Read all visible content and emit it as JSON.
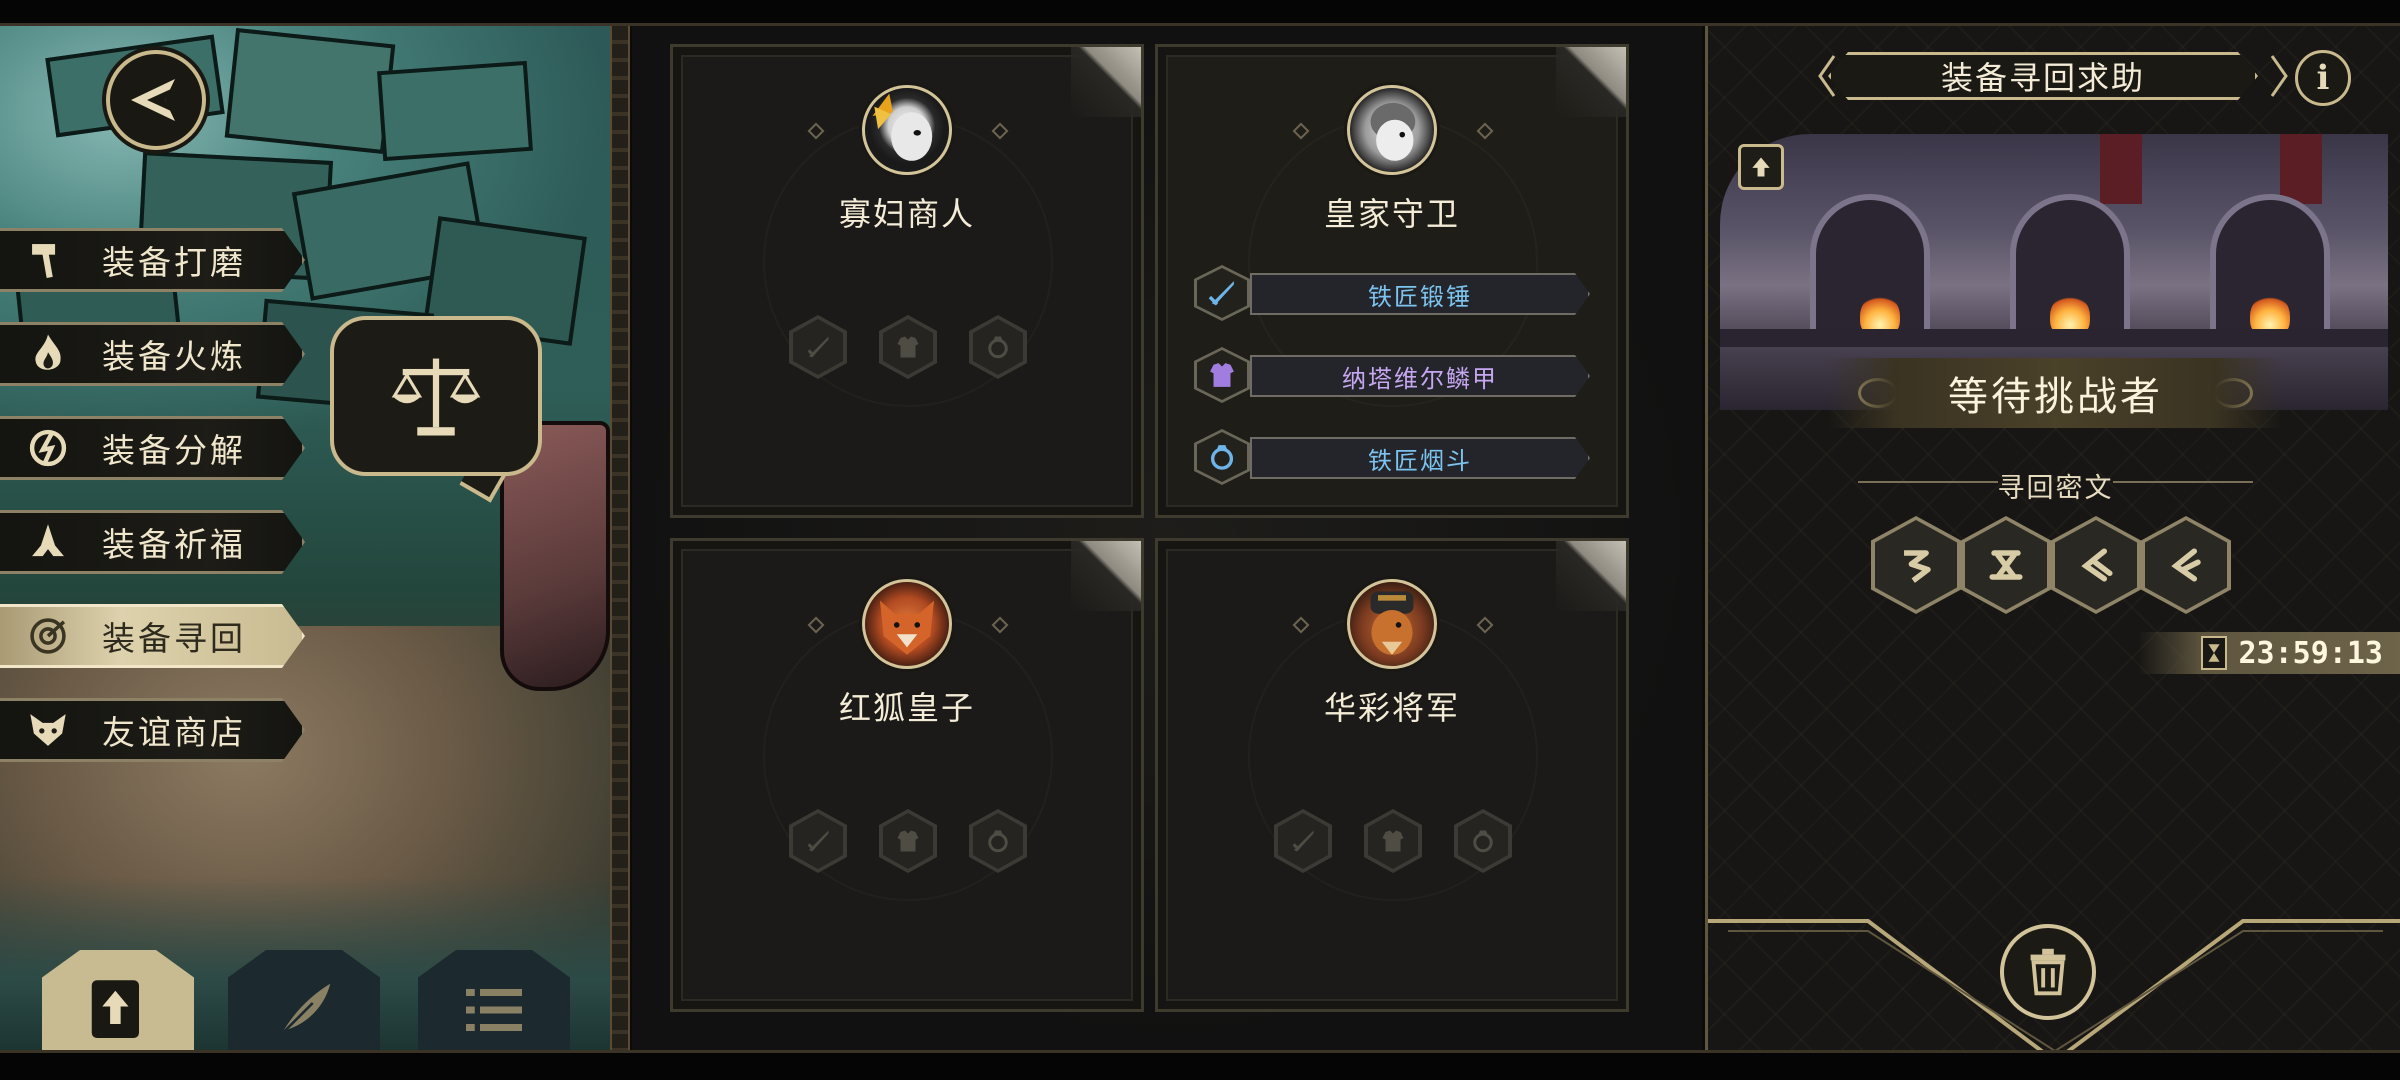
{
  "left_menu": {
    "items": [
      {
        "label": "装备打磨",
        "icon": "hammer-icon",
        "active": false
      },
      {
        "label": "装备火炼",
        "icon": "flame-icon",
        "active": false
      },
      {
        "label": "装备分解",
        "icon": "break-icon",
        "active": false
      },
      {
        "label": "装备祈福",
        "icon": "pray-hands-icon",
        "active": false
      },
      {
        "label": "装备寻回",
        "icon": "target-icon",
        "active": true
      },
      {
        "label": "友谊商店",
        "icon": "fox-icon",
        "active": false
      }
    ],
    "back_icon": "back-arrow-icon",
    "scale_icon": "balance-scale-icon",
    "bottom_buttons": [
      {
        "icon": "upload-doc-icon",
        "active": true
      },
      {
        "icon": "feather-icon",
        "active": false
      },
      {
        "icon": "list-icon",
        "active": false
      }
    ]
  },
  "cards": [
    {
      "name": "寡妇商人",
      "portrait": "widow-merchant-portrait",
      "slots": [
        "sword-slot",
        "armor-slot",
        "ring-slot"
      ]
    },
    {
      "name": "皇家守卫",
      "portrait": "royal-guard-portrait",
      "equipment": [
        {
          "label": "铁匠锻锤",
          "icon": "sword-icon",
          "color": "#7cc3f0"
        },
        {
          "label": "纳塔维尔鳞甲",
          "icon": "armor-icon",
          "color": "#c7a6f2"
        },
        {
          "label": "铁匠烟斗",
          "icon": "ring-icon",
          "color": "#7cc3f0"
        }
      ]
    },
    {
      "name": "红狐皇子",
      "portrait": "red-fox-prince-portrait",
      "slots": [
        "sword-slot",
        "armor-slot",
        "ring-slot"
      ]
    },
    {
      "name": "华彩将军",
      "portrait": "splendid-general-portrait",
      "slots": [
        "sword-slot",
        "armor-slot",
        "ring-slot"
      ]
    }
  ],
  "right_panel": {
    "title": "装备寻回求助",
    "info": "i",
    "status": "等待挑战者",
    "cipher_title": "寻回密文",
    "runes": [
      "rune-1-icon",
      "rune-2-icon",
      "rune-3-icon",
      "rune-4-icon"
    ],
    "timer": "23:59:13",
    "trash_icon": "trash-icon"
  },
  "colors": {
    "gold": "#c9b98d",
    "panel": "#1b1a18",
    "blue_text": "#7cc3f0",
    "purple_text": "#c7a6f2"
  }
}
